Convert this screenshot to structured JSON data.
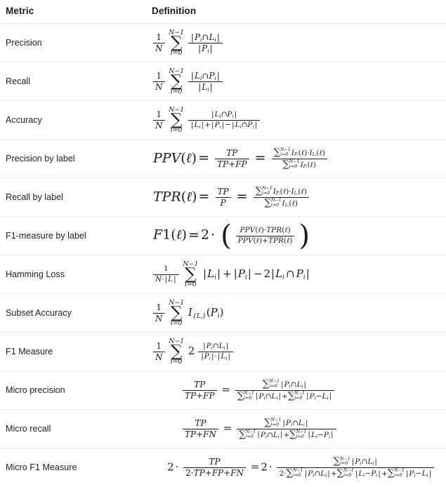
{
  "table": {
    "headers": {
      "metric": "Metric",
      "definition": "Definition"
    },
    "rows": [
      {
        "metric": "Precision",
        "definition_text": "1/N * sum_{i=0}^{N-1} |P_i ∩ L_i| / |P_i|"
      },
      {
        "metric": "Recall",
        "definition_text": "1/N * sum_{i=0}^{N-1} |L_i ∩ P_i| / |L_i|"
      },
      {
        "metric": "Accuracy",
        "definition_text": "1/N * sum_{i=0}^{N-1} |L_i ∩ P_i| / (|L_i| + |P_i| - |L_i ∩ P_i|)"
      },
      {
        "metric": "Precision by label",
        "definition_text": "PPV(l) = TP/(TP+FP) = sum_{i=0}^{N-1} I_{P_i}(l)·I_{L_i}(l) / sum_{i=0}^{N-1} I_{P_i}(l)"
      },
      {
        "metric": "Recall by label",
        "definition_text": "TPR(l) = TP/P = sum_{i=0}^{N-1} I_{P_i}(l)·I_{L_i}(l) / sum_{i=0}^{N-1} I_{L_i}(l)"
      },
      {
        "metric": "F1-measure by label",
        "definition_text": "F1(l) = 2 · ( PPV(l)·TPR(l) / (PPV(l)+TPR(l)) )"
      },
      {
        "metric": "Hamming Loss",
        "definition_text": "1/(N·|L|) sum_{i=0}^{N-1} |L_i| + |P_i| - 2|L_i ∩ P_i|"
      },
      {
        "metric": "Subset Accuracy",
        "definition_text": "1/N sum_{i=0}^{N-1} I_{{L_i}}(P_i)"
      },
      {
        "metric": "F1 Measure",
        "definition_text": "1/N sum_{i=0}^{N-1} 2 |P_i ∩ L_i| / (|P_i|·|L_i|)"
      },
      {
        "metric": "Micro precision",
        "definition_text": "TP/(TP+FP) = sum_{i=0}^{N-1}|P_i ∩ L_i| / (sum_{i=0}^{N-1}|P_i ∩ L_i| + sum_{i=0}^{N-1}|P_i - L_i|)"
      },
      {
        "metric": "Micro recall",
        "definition_text": "TP/(TP+FN) = sum_{i=0}^{N-1}|P_i ∩ L_i| / (sum_{i=0}^{N-1}|P_i ∩ L_i| + sum_{i=0}^{N-1}|L_i - P_i|)"
      },
      {
        "metric": "Micro F1 Measure",
        "definition_text": "2 · TP/(2·TP+FP+FN) = 2 · sum_{i=0}^{N-1}|P_i ∩ L_i| / (2·sum_{i=0}^{N-1}|P_i ∩ L_i| + sum_{i=0}^{N-1}|L_i - P_i| + sum_{i=0}^{N-1}|P_i - L_i|)"
      }
    ]
  },
  "symbols": {
    "one": "1",
    "two": "2",
    "N": "N",
    "N_minus_1": "N−1",
    "i_eq_0": "i=0",
    "sigma": "∑",
    "cap": "∩",
    "minus": "−",
    "plus": "+",
    "equals": "=",
    "cdot": "·",
    "bar": "|",
    "ell": "ℓ",
    "P": "P",
    "L": "L",
    "I": "I",
    "TP": "TP",
    "FP": "FP",
    "FN": "FN",
    "PPV": "PPV",
    "TPR": "TPR",
    "F1": "F1",
    "paren_open": "(",
    "paren_close": ")",
    "brace_open": "{",
    "brace_close": "}"
  },
  "colors": {
    "background": "#ffffff",
    "text": "#1c1c1c",
    "metric_text": "#222222",
    "rule": "#ebebeb",
    "header_rule": "#e6e6e6"
  }
}
